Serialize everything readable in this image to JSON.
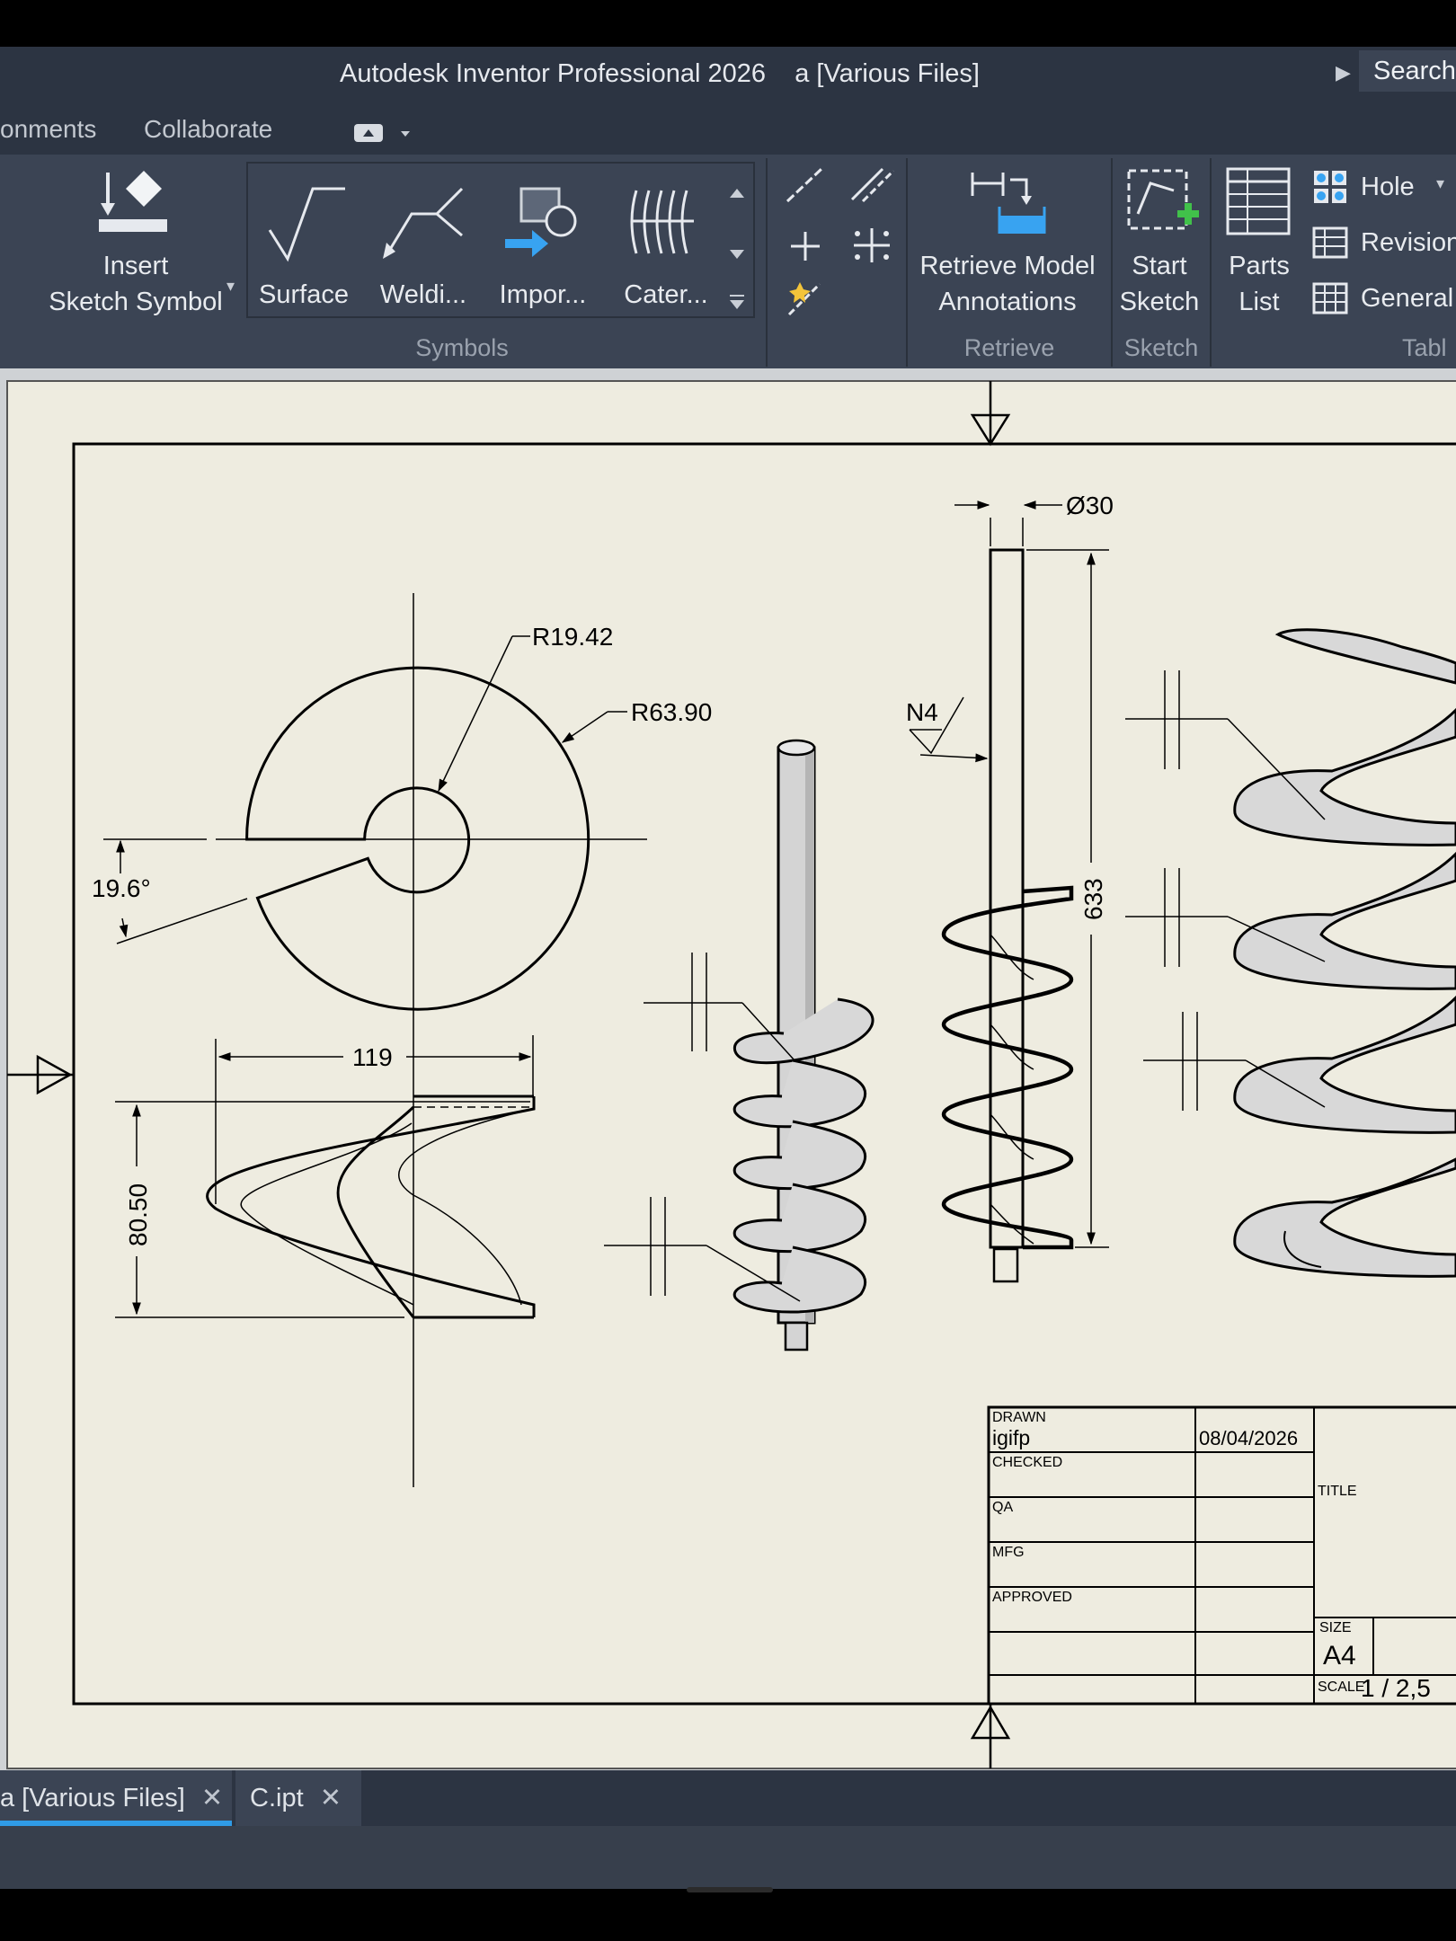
{
  "window": {
    "title": "Autodesk Inventor Professional 2026    a [Various Files]",
    "search_label": "Search"
  },
  "ribbon_tabs": [
    "onments",
    "Collaborate"
  ],
  "ribbon": {
    "insert_sketch_symbol": [
      "Insert",
      "Sketch Symbol"
    ],
    "symbols_gallery": [
      "Surface",
      "Weldi...",
      "Impor...",
      "Cater..."
    ],
    "retrieve_model_annotations": [
      "Retrieve Model",
      "Annotations"
    ],
    "start_sketch": [
      "Start",
      "Sketch"
    ],
    "parts_list": [
      "Parts",
      "List"
    ],
    "table_items": [
      "Hole",
      "Revision",
      "General"
    ],
    "groups": [
      "Symbols",
      "Retrieve",
      "Sketch",
      "Tabl"
    ]
  },
  "drawing": {
    "dimensions": {
      "r_inner": "R19.42",
      "r_outer": "R63.90",
      "angle": "19.6°",
      "width": "119",
      "height": "80.50",
      "diameter": "Ø30",
      "length": "633",
      "surface_finish": "N4"
    },
    "title_block": {
      "drawn_label": "DRAWN",
      "drawn_by": "igifp",
      "date": "08/04/2026",
      "checked_label": "CHECKED",
      "qa_label": "QA",
      "mfg_label": "MFG",
      "approved_label": "APPROVED",
      "title_label": "TITLE",
      "size_label": "SIZE",
      "size_value": "A4",
      "scale_label": "SCALE",
      "scale_value": "1 / 2,5"
    }
  },
  "document_tabs": [
    {
      "label": "a [Various Files]",
      "active": true
    },
    {
      "label": "C.ipt",
      "active": false
    }
  ],
  "colors": {
    "chrome": "#2c3442",
    "ribbon": "#3b4454",
    "sheet": "#eeece0",
    "active_tab_accent": "#2f9be6",
    "icon_green": "#41c14a",
    "icon_blue": "#38a3f1"
  }
}
